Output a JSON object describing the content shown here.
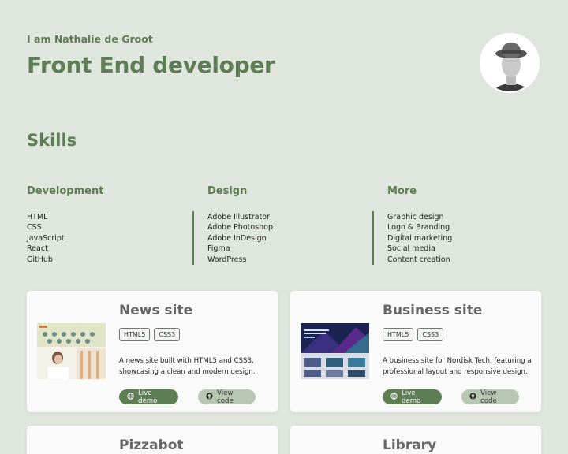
{
  "header": {
    "intro": "I am Nathalie de Groot",
    "title": "Front End developer"
  },
  "skills": {
    "heading": "Skills",
    "columns": [
      {
        "title": "Development",
        "items": [
          "HTML",
          "CSS",
          "JavaScript",
          "React",
          "GitHub"
        ]
      },
      {
        "title": "Design",
        "items": [
          "Adobe Illustrator",
          "Adobe Photoshop",
          "Adobe InDesign",
          "Figma",
          "WordPress"
        ]
      },
      {
        "title": "More",
        "items": [
          "Graphic design",
          "Logo & Branding",
          "Digital marketing",
          "Social media",
          "Content creation"
        ]
      }
    ]
  },
  "projects": [
    {
      "title": "News site",
      "tags": [
        "HTML5",
        "CSS3"
      ],
      "description": "A news site built with HTML5 and CSS3, showcasing a clean and modern design.",
      "live_label": "Live demo",
      "code_label": "View code"
    },
    {
      "title": "Business site",
      "tags": [
        "HTML5",
        "CSS3"
      ],
      "description": "A business site for Nordisk Tech, featuring a professional layout and responsive design.",
      "live_label": "Live demo",
      "code_label": "View code"
    },
    {
      "title": "Pizzabot"
    },
    {
      "title": "Library"
    }
  ],
  "colors": {
    "background": "#dfe6dd",
    "accent": "#5d7d52",
    "button_secondary": "#b7c7b1",
    "card": "#f9faf9"
  },
  "icons": {
    "live": "globe-icon",
    "code": "github-icon"
  }
}
